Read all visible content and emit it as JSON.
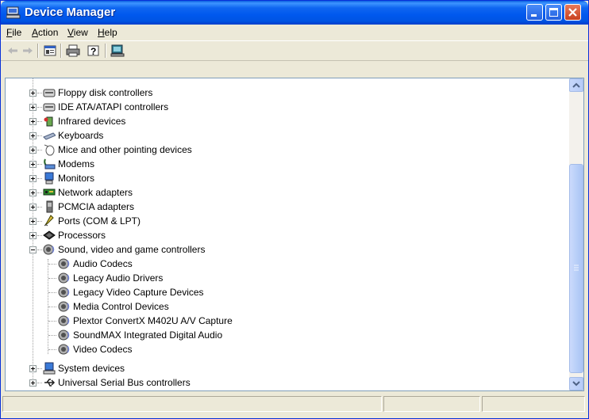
{
  "window": {
    "title": "Device Manager"
  },
  "menu": [
    {
      "label_u": "F",
      "label_rest": "ile"
    },
    {
      "label_u": "A",
      "label_rest": "ction"
    },
    {
      "label_u": "V",
      "label_rest": "iew"
    },
    {
      "label_u": "H",
      "label_rest": "elp"
    }
  ],
  "toolbar": {
    "buttons": [
      "back-icon",
      "forward-icon",
      "properties-icon",
      "print-icon",
      "help-icon",
      "scan-hardware-icon"
    ]
  },
  "tree": {
    "items": [
      {
        "label": "Floppy disk controllers",
        "icon": "floppy-controller-icon"
      },
      {
        "label": "IDE ATA/ATAPI controllers",
        "icon": "ide-controller-icon"
      },
      {
        "label": "Infrared devices",
        "icon": "infrared-icon"
      },
      {
        "label": "Keyboards",
        "icon": "keyboard-icon"
      },
      {
        "label": "Mice and other pointing devices",
        "icon": "mouse-icon"
      },
      {
        "label": "Modems",
        "icon": "modem-icon"
      },
      {
        "label": "Monitors",
        "icon": "monitor-icon"
      },
      {
        "label": "Network adapters",
        "icon": "network-adapter-icon"
      },
      {
        "label": "PCMCIA adapters",
        "icon": "pcmcia-icon"
      },
      {
        "label": "Ports (COM & LPT)",
        "icon": "port-icon"
      },
      {
        "label": "Processors",
        "icon": "processor-icon"
      },
      {
        "label": "Sound, video and game controllers",
        "icon": "sound-icon",
        "expanded": true,
        "children": [
          "Audio Codecs",
          "Legacy Audio Drivers",
          "Legacy Video Capture Devices",
          "Media Control Devices",
          "Plextor ConvertX M402U A/V Capture",
          "SoundMAX Integrated Digital Audio",
          "Video Codecs"
        ]
      },
      {
        "label": "System devices",
        "icon": "system-device-icon"
      },
      {
        "label": "Universal Serial Bus controllers",
        "icon": "usb-icon"
      }
    ]
  }
}
